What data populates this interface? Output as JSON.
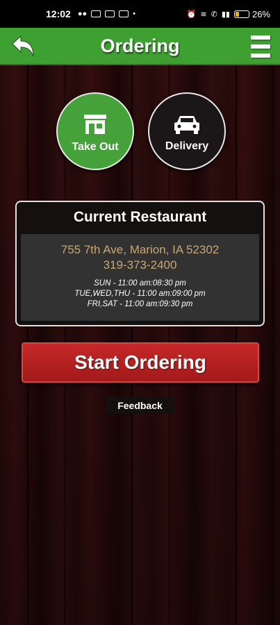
{
  "status_bar": {
    "time": "12:02",
    "battery": "26%"
  },
  "header": {
    "title": "Ordering"
  },
  "order_types": {
    "takeout_label": "Take Out",
    "delivery_label": "Delivery",
    "selected": "Take Out"
  },
  "restaurant": {
    "heading": "Current Restaurant",
    "address": "755 7th Ave, Marion, IA 52302",
    "phone": "319-373-2400",
    "hours": [
      "SUN - 11:00 am:08:30 pm",
      "TUE,WED,THU - 11:00 am:09:00 pm",
      "FRI,SAT - 11:00 am:09:30 pm"
    ]
  },
  "actions": {
    "start_ordering": "Start Ordering",
    "feedback": "Feedback"
  },
  "colors": {
    "header_green": "#3fa032",
    "button_red": "#c62828",
    "address_gold": "#c6a775"
  }
}
